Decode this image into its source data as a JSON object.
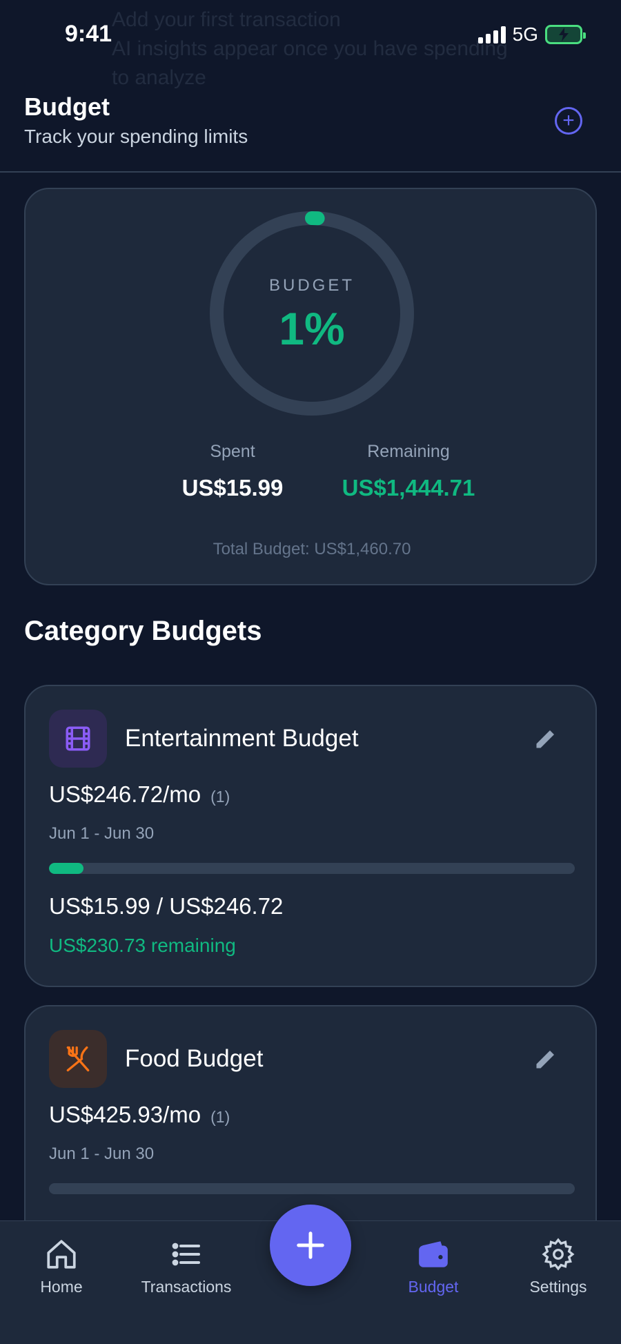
{
  "status": {
    "time": "9:41",
    "network": "5G"
  },
  "ghost_text": {
    "lines": [
      "Add your first transaction",
      "AI insights appear once you have spending",
      "to analyze"
    ]
  },
  "header": {
    "title": "Budget",
    "subtitle": "Track your spending limits",
    "add_icon": "plus-circle-icon"
  },
  "summary": {
    "ring_label": "BUDGET",
    "percent_text": "1%",
    "percent_value": 0.01,
    "spent_label": "Spent",
    "spent_value": "US$15.99",
    "remaining_label": "Remaining",
    "remaining_value": "US$1,444.71",
    "total_text": "Total Budget: US$1,460.70",
    "colors": {
      "accent": "#10b981",
      "track": "#334155"
    }
  },
  "section_title": "Category Budgets",
  "categories": [
    {
      "name": "Entertainment Budget",
      "icon": "film-icon",
      "amount": "US$246.72/mo",
      "count": "(1)",
      "period": "Jun 1 - Jun 30",
      "progress": 0.065,
      "spent_text": "US$15.99 / US$246.72",
      "remaining_text": "US$230.73 remaining",
      "icon_color": "#8b5cf6",
      "icon_bg": "#2e2a52"
    },
    {
      "name": "Food Budget",
      "icon": "utensils-icon",
      "amount": "US$425.93/mo",
      "count": "(1)",
      "period": "Jun 1 - Jun 30",
      "progress": 0,
      "icon_color": "#f97316",
      "icon_bg": "#3b2d2b"
    }
  ],
  "tabs": [
    {
      "label": "Home",
      "icon": "home-icon"
    },
    {
      "label": "Transactions",
      "icon": "list-icon"
    },
    {
      "label": "Budget",
      "icon": "wallet-icon",
      "active": true
    },
    {
      "label": "Settings",
      "icon": "gear-icon"
    }
  ],
  "fab_icon": "plus-icon",
  "accent_color": "#6366f1"
}
